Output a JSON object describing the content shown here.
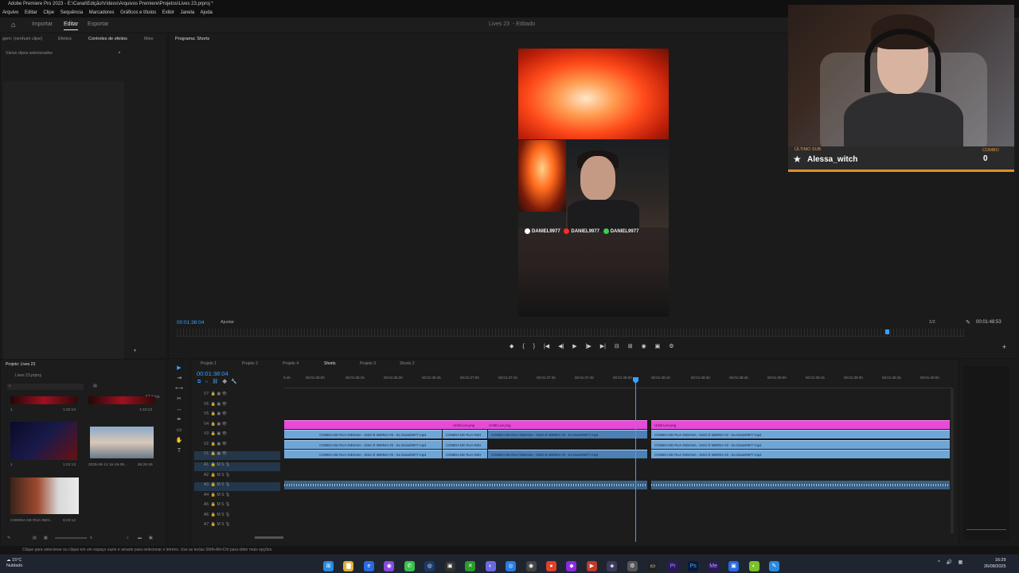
{
  "window": {
    "title": "Adobe Premiere Pro 2023 - E:\\Canal\\Edição\\Vídeos\\Arquivos Premiere\\Projetos\\Lives 23.prproj *"
  },
  "menu": [
    "Arquivo",
    "Editar",
    "Clipe",
    "Sequência",
    "Marcadores",
    "Gráficos e títulos",
    "Exibir",
    "Janela",
    "Ajuda"
  ],
  "header": {
    "tabs": [
      "Importar",
      "Editar",
      "Exportar"
    ],
    "active_tab": "Editar",
    "doc_title": "Lives 23",
    "doc_status": "Editado"
  },
  "effects_panel": {
    "tabs": [
      "gem: (nenhum clipe)",
      "Efeitos",
      "Controles de efeitos",
      "Mixe"
    ],
    "active_tab": "Controles de efeitos",
    "selection_text": "Vários clipes selecionados"
  },
  "program_monitor": {
    "tab_label": "Programa: Shorts",
    "timecode_left": "00:01:38:04",
    "fit_label": "Ajustar",
    "page_indicator": "1/2",
    "timecode_right": "00:01:48:53",
    "overlay_text": [
      "DANIEL9977",
      "DANIEL9977",
      "DANIEL9977"
    ]
  },
  "webcam": {
    "last_sub_label": "ÚLTIMO SUB",
    "last_sub_name": "Alessa_witch",
    "combo_label": "COMBO",
    "combo_value": "0"
  },
  "project_panel": {
    "title": "Projeto: Lives 23",
    "file": "Lives 23.prproj",
    "item_count": "57 itens",
    "items": [
      {
        "name": "1",
        "duration": "1:22:13"
      },
      {
        "name": "",
        "duration": "1:23:13"
      },
      {
        "name": "1",
        "duration": "1:22:13"
      },
      {
        "name": "2025-08-13 16-15-09...",
        "duration": "55:28:46"
      },
      {
        "name": "COMIDA DE RUA INDI...",
        "duration": "9:23:12"
      }
    ]
  },
  "timeline": {
    "sequence_tabs": [
      "Projeto 1",
      "Projeto 2",
      "Projeto 4",
      "Shorts",
      "Projeto 3",
      "Shorts 2"
    ],
    "active_sequence": "Shorts",
    "timecode": "00:01:38:04",
    "ruler_labels": [
      "5:45",
      "00:01:36:00",
      "00:01:36:15",
      "00:01:36:30",
      "00:01:36:45",
      "00:01:37:00",
      "00:01:37:15",
      "00:01:37:30",
      "00:01:37:45",
      "00:01:38:00",
      "00:01:38:15",
      "00:01:38:30",
      "00:01:38:45",
      "00:01:39:00",
      "00:01:39:15",
      "00:01:39:30",
      "00:01:39:45",
      "00:01:40:00"
    ],
    "video_tracks": [
      "V7",
      "V6",
      "V5",
      "V4",
      "V3",
      "V2",
      "V1"
    ],
    "audio_tracks": [
      "A1",
      "A2",
      "A3",
      "A4",
      "A5",
      "A6",
      "A7"
    ],
    "clip_labels": {
      "pink": "Untitl Live.png",
      "blue": "COMIDA DE RUA INDIANA - ISSO É MERDA #2 - Ex Daniel9977.mp4",
      "blue_short": "COMIDA DE RUA INDI"
    }
  },
  "status_bar": {
    "text": "Clique para selecionar ou clique em um espaço vazio e arraste para selecionar o letreiro. Use as teclas Shift+Alt+Ctrl para obter mais opções."
  },
  "taskbar": {
    "weather_temp": "15°C",
    "weather_desc": "Nublado",
    "time": "16:29",
    "date": "26/08/2025"
  }
}
